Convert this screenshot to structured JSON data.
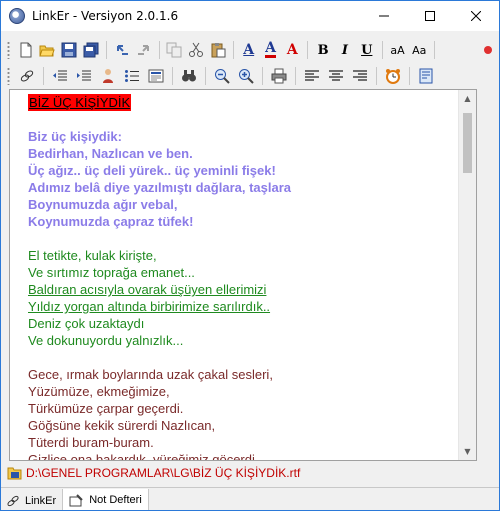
{
  "window": {
    "title": "LinkEr - Versiyon 2.0.1.6",
    "controls": {
      "minimize": "—",
      "maximize": "☐",
      "close": "✕"
    }
  },
  "toolbar1": {
    "items": [
      {
        "name": "new-document",
        "icon": "new-document-icon"
      },
      {
        "name": "open-folder",
        "icon": "open-folder-icon"
      },
      {
        "name": "save",
        "icon": "save-icon"
      },
      {
        "name": "save-all",
        "icon": "save-all-icon"
      },
      {
        "name": "undo",
        "icon": "undo-icon"
      },
      {
        "name": "redo",
        "icon": "redo-icon"
      },
      {
        "name": "copy",
        "icon": "copy-icon"
      },
      {
        "name": "cut",
        "icon": "cut-icon"
      },
      {
        "name": "paste",
        "icon": "paste-icon"
      },
      {
        "name": "font",
        "label": "A"
      },
      {
        "name": "font-color",
        "label": "A"
      },
      {
        "name": "highlight-color",
        "label": "A"
      },
      {
        "name": "bold",
        "label": "B"
      },
      {
        "name": "italic",
        "label": "I"
      },
      {
        "name": "underline",
        "label": "U"
      },
      {
        "name": "superscript",
        "label": "aA"
      },
      {
        "name": "subscript",
        "label": "Aa"
      },
      {
        "name": "record",
        "icon": "record-icon"
      }
    ]
  },
  "toolbar2": {
    "items": [
      {
        "name": "link",
        "icon": "link-icon"
      },
      {
        "name": "outdent",
        "icon": "outdent-icon"
      },
      {
        "name": "indent",
        "icon": "indent-icon"
      },
      {
        "name": "person",
        "icon": "person-icon"
      },
      {
        "name": "bullets",
        "icon": "bullets-icon"
      },
      {
        "name": "picture",
        "icon": "picture-icon"
      },
      {
        "name": "find",
        "icon": "binoculars-icon"
      },
      {
        "name": "zoom-out",
        "icon": "zoom-out-icon"
      },
      {
        "name": "zoom-in",
        "icon": "zoom-in-icon"
      },
      {
        "name": "print",
        "icon": "print-icon"
      },
      {
        "name": "align-left",
        "icon": "align-left-icon"
      },
      {
        "name": "align-center",
        "icon": "align-center-icon"
      },
      {
        "name": "align-right",
        "icon": "align-right-icon"
      },
      {
        "name": "alarm",
        "icon": "alarm-clock-icon"
      },
      {
        "name": "settings",
        "icon": "panel-icon"
      }
    ]
  },
  "document": {
    "title": "BİZ ÜÇ KİŞİYDİK",
    "stanza1": [
      "Biz üç kişiydik:",
      "Bedirhan, Nazlıcan ve ben.",
      "Üç ağız.. üç deli yürek.. üç yeminli fişek!",
      "Adımız belâ diye yazılmıştı dağlara, taşlara",
      "Boynumuzda ağır vebal,",
      "Koynumuzda çapraz tüfek!"
    ],
    "stanza2": [
      "El tetikte, kulak kirişte,",
      "Ve sırtımız toprağa emanet...",
      "Baldıran acısıyla ovarak üşüyen ellerimizi",
      "Yıldız yorgan altında birbirimize sarılırdık..",
      "Deniz çok uzaktaydı",
      "Ve dokunuyordu yalnızlık..."
    ],
    "stanza3": [
      "Gece, ırmak boylarında uzak çakal sesleri,",
      "Yüzümüze, ekmeğimize,",
      "Türkümüze çarpar geçerdi.",
      "Göğsüne kekik sürerdi Nazlıcan,",
      "Tüterdi buram-buram.",
      "Gizlice ona bakardık, yüreğimiz göçerdi..."
    ]
  },
  "statusbar": {
    "path": "D:\\GENEL PROGRAMLAR\\LG\\BİZ ÜÇ KİŞİYDİK.rtf"
  },
  "tabs": [
    {
      "label": "LinkEr",
      "active": false
    },
    {
      "label": "Not Defteri",
      "active": true
    }
  ]
}
